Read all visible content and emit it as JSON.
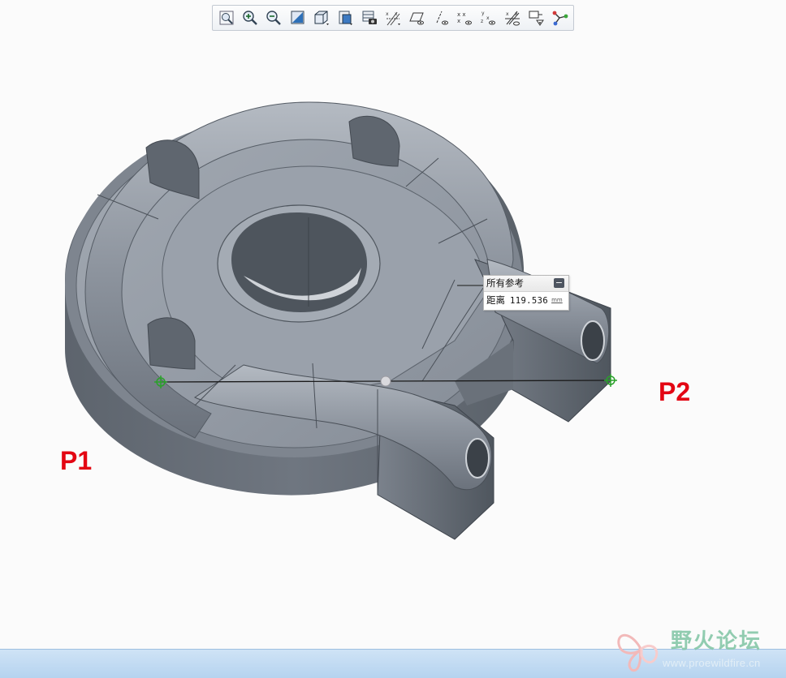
{
  "toolbar": {
    "items": [
      {
        "name": "refit-icon"
      },
      {
        "name": "zoom-in-icon"
      },
      {
        "name": "zoom-out-icon"
      },
      {
        "name": "repaint-icon"
      },
      {
        "name": "display-style-icon"
      },
      {
        "name": "saved-orientations-icon"
      },
      {
        "name": "view-manager-icon"
      },
      {
        "name": "datum-display-filters-icon"
      },
      {
        "name": "plane-display-icon"
      },
      {
        "name": "axis-display-icon"
      },
      {
        "name": "point-display-icon"
      },
      {
        "name": "csys-display-icon"
      },
      {
        "name": "spin-center-icon"
      },
      {
        "name": "annotation-display-icon"
      }
    ]
  },
  "popup": {
    "header": "所有参考",
    "distance_label": "距离",
    "distance_value": "119.536",
    "unit": "mm"
  },
  "labels": {
    "p1": "P1",
    "p2": "P2"
  },
  "watermark": {
    "title": "野火论坛",
    "url": "www.proewildfire.cn"
  },
  "colors": {
    "label_red": "#e30613",
    "measure_point_green": "#2aa12a",
    "model_gray": "#8a929c",
    "statusbar_blue": "#b5d3ef"
  }
}
